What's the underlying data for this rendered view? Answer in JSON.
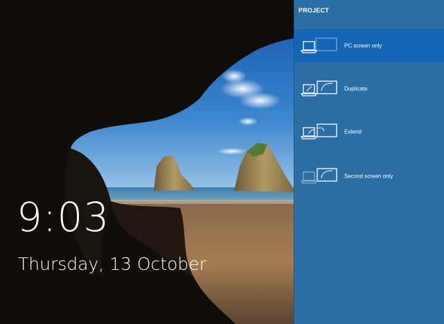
{
  "lockscreen": {
    "time": "9:03",
    "date": "Thursday, 13 October"
  },
  "project_panel": {
    "title": "PROJECT",
    "options": [
      {
        "label": "PC screen only",
        "icon": "pc-screen-only-icon",
        "selected": true
      },
      {
        "label": "Duplicate",
        "icon": "duplicate-icon",
        "selected": false
      },
      {
        "label": "Extend",
        "icon": "extend-icon",
        "selected": false
      },
      {
        "label": "Second screen only",
        "icon": "second-screen-only-icon",
        "selected": false
      }
    ]
  },
  "colors": {
    "panel_bg": "#2b6ea6",
    "selected_bg": "#1565b7",
    "text": "#ffffff"
  }
}
